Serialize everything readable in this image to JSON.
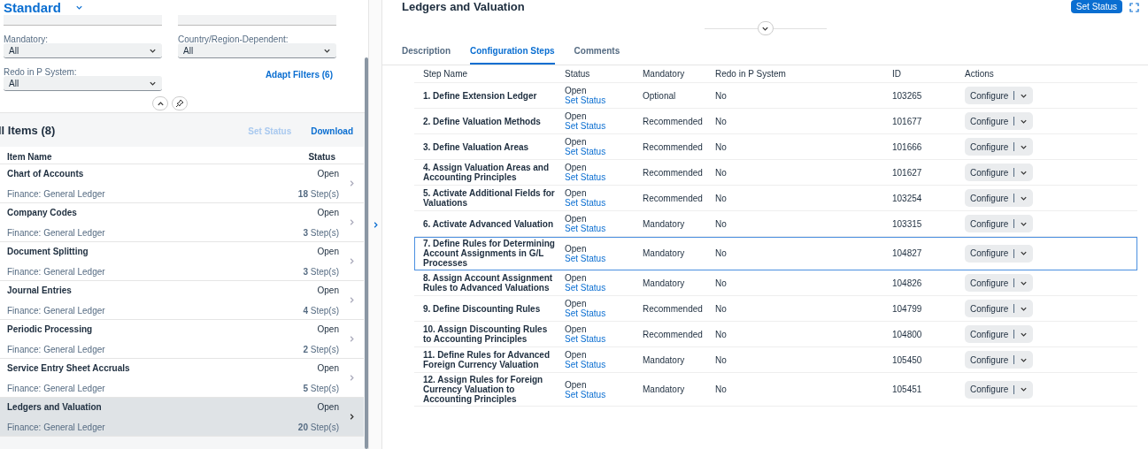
{
  "variant": {
    "title": "Standard"
  },
  "filters": [
    {
      "label": "Mandatory:",
      "value": "All"
    },
    {
      "label": "Country/Region-Dependent:",
      "value": "All"
    },
    {
      "label": "Redo in P System:",
      "value": "All"
    }
  ],
  "adapt_filters": "Adapt Filters (6)",
  "list": {
    "title": "ll Items (8)",
    "actions": [
      {
        "label": "Set Status",
        "disabled": true
      },
      {
        "label": "Download",
        "disabled": false
      }
    ],
    "columns": [
      "Item Name",
      "Status"
    ],
    "items": [
      {
        "name": "Chart of Accounts",
        "category": "Finance: General Ledger",
        "status": "Open",
        "steps": "**18** Step(s)",
        "selected": false
      },
      {
        "name": "Company Codes",
        "category": "Finance: General Ledger",
        "status": "Open",
        "steps": "**3** Step(s)",
        "selected": false
      },
      {
        "name": "Document Splitting",
        "category": "Finance: General Ledger",
        "status": "Open",
        "steps": "**3** Step(s)",
        "selected": false
      },
      {
        "name": "Journal Entries",
        "category": "Finance: General Ledger",
        "status": "Open",
        "steps": "**4** Step(s)",
        "selected": false
      },
      {
        "name": "Periodic Processing",
        "category": "Finance: General Ledger",
        "status": "Open",
        "steps": "**2** Step(s)",
        "selected": false
      },
      {
        "name": "Service Entry Sheet Accruals",
        "category": "Finance: General Ledger",
        "status": "Open",
        "steps": "**5** Step(s)",
        "selected": false
      },
      {
        "name": "Ledgers and Valuation",
        "category": "Finance: General Ledger",
        "status": "Open",
        "steps": "**20** Step(s)",
        "selected": true
      }
    ]
  },
  "detail": {
    "title": "Ledgers and Valuation",
    "set_status": "Set Status",
    "tabs": [
      {
        "label": "Description",
        "selected": false
      },
      {
        "label": "Configuration Steps",
        "selected": true
      },
      {
        "label": "Comments",
        "selected": false
      }
    ],
    "columns": [
      "Step Name",
      "Status",
      "Mandatory",
      "Redo in P System",
      "ID",
      "Actions"
    ],
    "rows": [
      {
        "name": "1. Define Extension Ledger",
        "status": "Open",
        "status_link": "Set Status",
        "mandatory": "Optional",
        "redo": "No",
        "id": "103265",
        "action": "Configure",
        "selected": false
      },
      {
        "name": "2. Define Valuation Methods",
        "status": "Open",
        "status_link": "Set Status",
        "mandatory": "Recommended",
        "redo": "No",
        "id": "101677",
        "action": "Configure",
        "selected": false
      },
      {
        "name": "3. Define Valuation Areas",
        "status": "Open",
        "status_link": "Set Status",
        "mandatory": "Recommended",
        "redo": "No",
        "id": "101666",
        "action": "Configure",
        "selected": false
      },
      {
        "name": "4. Assign Valuation Areas and Accounting Principles",
        "status": "Open",
        "status_link": "Set Status",
        "mandatory": "Recommended",
        "redo": "No",
        "id": "101627",
        "action": "Configure",
        "selected": false
      },
      {
        "name": "5. Activate Additional Fields for Valuations",
        "status": "Open",
        "status_link": "Set Status",
        "mandatory": "Recommended",
        "redo": "No",
        "id": "103254",
        "action": "Configure",
        "selected": false
      },
      {
        "name": "6. Activate Advanced Valuation",
        "status": "Open",
        "status_link": "Set Status",
        "mandatory": "Mandatory",
        "redo": "No",
        "id": "103315",
        "action": "Configure",
        "selected": false
      },
      {
        "name": "7. Define Rules for Determining Account Assignments in G/L Processes",
        "status": "Open",
        "status_link": "Set Status",
        "mandatory": "Mandatory",
        "redo": "No",
        "id": "104827",
        "action": "Configure",
        "selected": true
      },
      {
        "name": "8. Assign Account Assignment Rules to Advanced Valuations",
        "status": "Open",
        "status_link": "Set Status",
        "mandatory": "Mandatory",
        "redo": "No",
        "id": "104826",
        "action": "Configure",
        "selected": false
      },
      {
        "name": "9. Define Discounting Rules",
        "status": "Open",
        "status_link": "Set Status",
        "mandatory": "Recommended",
        "redo": "No",
        "id": "104799",
        "action": "Configure",
        "selected": false
      },
      {
        "name": "10. Assign Discounting Rules to Accounting Principles",
        "status": "Open",
        "status_link": "Set Status",
        "mandatory": "Recommended",
        "redo": "No",
        "id": "104800",
        "action": "Configure",
        "selected": false
      },
      {
        "name": "11. Define Rules for Advanced Foreign Currency Valuation",
        "status": "Open",
        "status_link": "Set Status",
        "mandatory": "Mandatory",
        "redo": "No",
        "id": "105450",
        "action": "Configure",
        "selected": false
      },
      {
        "name": "12. Assign Rules for Foreign Currency Valuation to Accounting Principles",
        "status": "Open",
        "status_link": "Set Status",
        "mandatory": "Mandatory",
        "redo": "No",
        "id": "105451",
        "action": "Configure",
        "selected": false
      }
    ]
  }
}
